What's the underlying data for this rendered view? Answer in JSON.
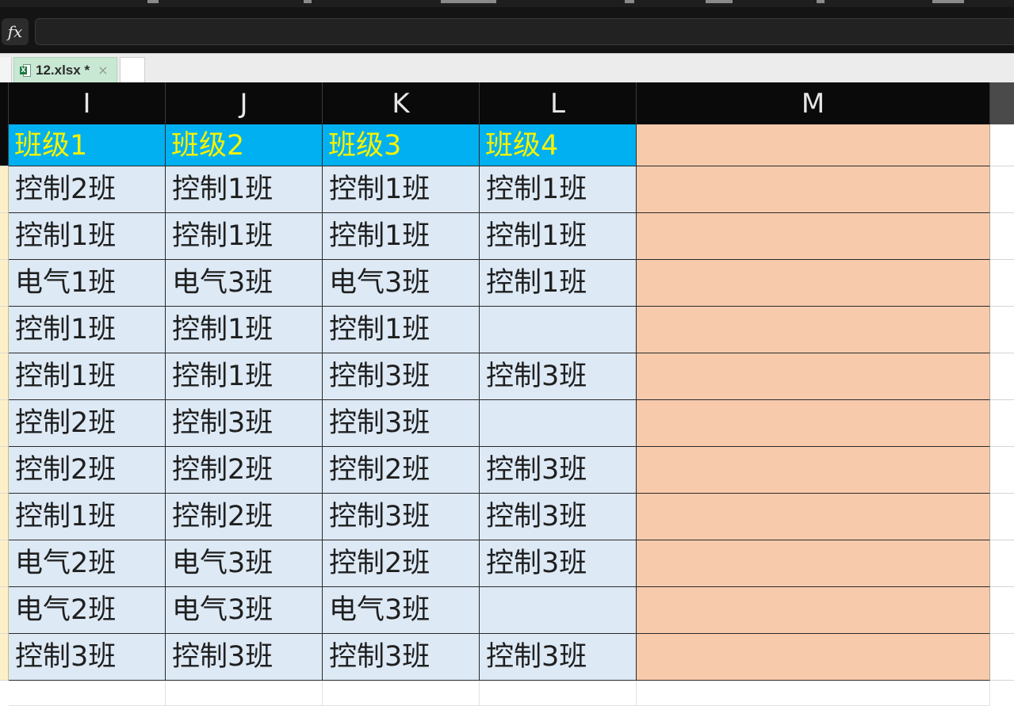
{
  "formula_bar": {
    "fx_label": "fx",
    "value": ""
  },
  "tabs": {
    "file_tab_title": "12.xlsx *",
    "close_glyph": "×",
    "file_icon_letter": "X"
  },
  "columns": [
    "I",
    "J",
    "K",
    "L",
    "M"
  ],
  "header_row": [
    "班级1",
    "班级2",
    "班级3",
    "班级4",
    ""
  ],
  "rows": [
    [
      "控制2班",
      "控制1班",
      "控制1班",
      "控制1班",
      ""
    ],
    [
      "控制1班",
      "控制1班",
      "控制1班",
      "控制1班",
      ""
    ],
    [
      "电气1班",
      "电气3班",
      "电气3班",
      "控制1班",
      ""
    ],
    [
      "控制1班",
      "控制1班",
      "控制1班",
      "",
      ""
    ],
    [
      "控制1班",
      "控制1班",
      "控制3班",
      "控制3班",
      ""
    ],
    [
      "控制2班",
      "控制3班",
      "控制3班",
      "",
      ""
    ],
    [
      "控制2班",
      "控制2班",
      "控制2班",
      "控制3班",
      ""
    ],
    [
      "控制1班",
      "控制2班",
      "控制3班",
      "控制3班",
      ""
    ],
    [
      "电气2班",
      "电气3班",
      "控制2班",
      "控制3班",
      ""
    ],
    [
      "电气2班",
      "电气3班",
      "电气3班",
      "",
      ""
    ],
    [
      "控制3班",
      "控制3班",
      "控制3班",
      "控制3班",
      ""
    ]
  ],
  "colors": {
    "header_fill": "#00b0f0",
    "header_text": "#f7f200",
    "data_fill": "#dde9f5",
    "column_m_fill": "#f7caac",
    "tab_active_fill": "#c9e8d4"
  },
  "icons": {
    "file_tab_icon": "excel-file-icon",
    "close": "close-icon",
    "function": "fx-icon"
  }
}
